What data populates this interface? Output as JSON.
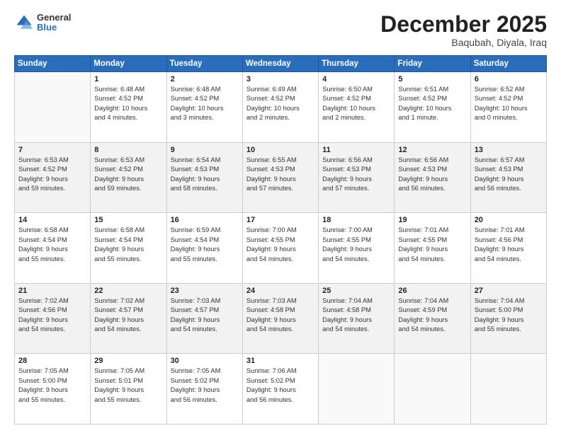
{
  "header": {
    "logo_general": "General",
    "logo_blue": "Blue",
    "month_title": "December 2025",
    "subtitle": "Baqubah, Diyala, Iraq"
  },
  "days_of_week": [
    "Sunday",
    "Monday",
    "Tuesday",
    "Wednesday",
    "Thursday",
    "Friday",
    "Saturday"
  ],
  "weeks": [
    [
      {
        "day": "",
        "info": ""
      },
      {
        "day": "1",
        "info": "Sunrise: 6:48 AM\nSunset: 4:52 PM\nDaylight: 10 hours\nand 4 minutes."
      },
      {
        "day": "2",
        "info": "Sunrise: 6:48 AM\nSunset: 4:52 PM\nDaylight: 10 hours\nand 3 minutes."
      },
      {
        "day": "3",
        "info": "Sunrise: 6:49 AM\nSunset: 4:52 PM\nDaylight: 10 hours\nand 2 minutes."
      },
      {
        "day": "4",
        "info": "Sunrise: 6:50 AM\nSunset: 4:52 PM\nDaylight: 10 hours\nand 2 minutes."
      },
      {
        "day": "5",
        "info": "Sunrise: 6:51 AM\nSunset: 4:52 PM\nDaylight: 10 hours\nand 1 minute."
      },
      {
        "day": "6",
        "info": "Sunrise: 6:52 AM\nSunset: 4:52 PM\nDaylight: 10 hours\nand 0 minutes."
      }
    ],
    [
      {
        "day": "7",
        "info": "Sunrise: 6:53 AM\nSunset: 4:52 PM\nDaylight: 9 hours\nand 59 minutes."
      },
      {
        "day": "8",
        "info": "Sunrise: 6:53 AM\nSunset: 4:52 PM\nDaylight: 9 hours\nand 59 minutes."
      },
      {
        "day": "9",
        "info": "Sunrise: 6:54 AM\nSunset: 4:53 PM\nDaylight: 9 hours\nand 58 minutes."
      },
      {
        "day": "10",
        "info": "Sunrise: 6:55 AM\nSunset: 4:53 PM\nDaylight: 9 hours\nand 57 minutes."
      },
      {
        "day": "11",
        "info": "Sunrise: 6:56 AM\nSunset: 4:53 PM\nDaylight: 9 hours\nand 57 minutes."
      },
      {
        "day": "12",
        "info": "Sunrise: 6:56 AM\nSunset: 4:53 PM\nDaylight: 9 hours\nand 56 minutes."
      },
      {
        "day": "13",
        "info": "Sunrise: 6:57 AM\nSunset: 4:53 PM\nDaylight: 9 hours\nand 56 minutes."
      }
    ],
    [
      {
        "day": "14",
        "info": "Sunrise: 6:58 AM\nSunset: 4:54 PM\nDaylight: 9 hours\nand 55 minutes."
      },
      {
        "day": "15",
        "info": "Sunrise: 6:58 AM\nSunset: 4:54 PM\nDaylight: 9 hours\nand 55 minutes."
      },
      {
        "day": "16",
        "info": "Sunrise: 6:59 AM\nSunset: 4:54 PM\nDaylight: 9 hours\nand 55 minutes."
      },
      {
        "day": "17",
        "info": "Sunrise: 7:00 AM\nSunset: 4:55 PM\nDaylight: 9 hours\nand 54 minutes."
      },
      {
        "day": "18",
        "info": "Sunrise: 7:00 AM\nSunset: 4:55 PM\nDaylight: 9 hours\nand 54 minutes."
      },
      {
        "day": "19",
        "info": "Sunrise: 7:01 AM\nSunset: 4:55 PM\nDaylight: 9 hours\nand 54 minutes."
      },
      {
        "day": "20",
        "info": "Sunrise: 7:01 AM\nSunset: 4:56 PM\nDaylight: 9 hours\nand 54 minutes."
      }
    ],
    [
      {
        "day": "21",
        "info": "Sunrise: 7:02 AM\nSunset: 4:56 PM\nDaylight: 9 hours\nand 54 minutes."
      },
      {
        "day": "22",
        "info": "Sunrise: 7:02 AM\nSunset: 4:57 PM\nDaylight: 9 hours\nand 54 minutes."
      },
      {
        "day": "23",
        "info": "Sunrise: 7:03 AM\nSunset: 4:57 PM\nDaylight: 9 hours\nand 54 minutes."
      },
      {
        "day": "24",
        "info": "Sunrise: 7:03 AM\nSunset: 4:58 PM\nDaylight: 9 hours\nand 54 minutes."
      },
      {
        "day": "25",
        "info": "Sunrise: 7:04 AM\nSunset: 4:58 PM\nDaylight: 9 hours\nand 54 minutes."
      },
      {
        "day": "26",
        "info": "Sunrise: 7:04 AM\nSunset: 4:59 PM\nDaylight: 9 hours\nand 54 minutes."
      },
      {
        "day": "27",
        "info": "Sunrise: 7:04 AM\nSunset: 5:00 PM\nDaylight: 9 hours\nand 55 minutes."
      }
    ],
    [
      {
        "day": "28",
        "info": "Sunrise: 7:05 AM\nSunset: 5:00 PM\nDaylight: 9 hours\nand 55 minutes."
      },
      {
        "day": "29",
        "info": "Sunrise: 7:05 AM\nSunset: 5:01 PM\nDaylight: 9 hours\nand 55 minutes."
      },
      {
        "day": "30",
        "info": "Sunrise: 7:05 AM\nSunset: 5:02 PM\nDaylight: 9 hours\nand 56 minutes."
      },
      {
        "day": "31",
        "info": "Sunrise: 7:06 AM\nSunset: 5:02 PM\nDaylight: 9 hours\nand 56 minutes."
      },
      {
        "day": "",
        "info": ""
      },
      {
        "day": "",
        "info": ""
      },
      {
        "day": "",
        "info": ""
      }
    ]
  ]
}
